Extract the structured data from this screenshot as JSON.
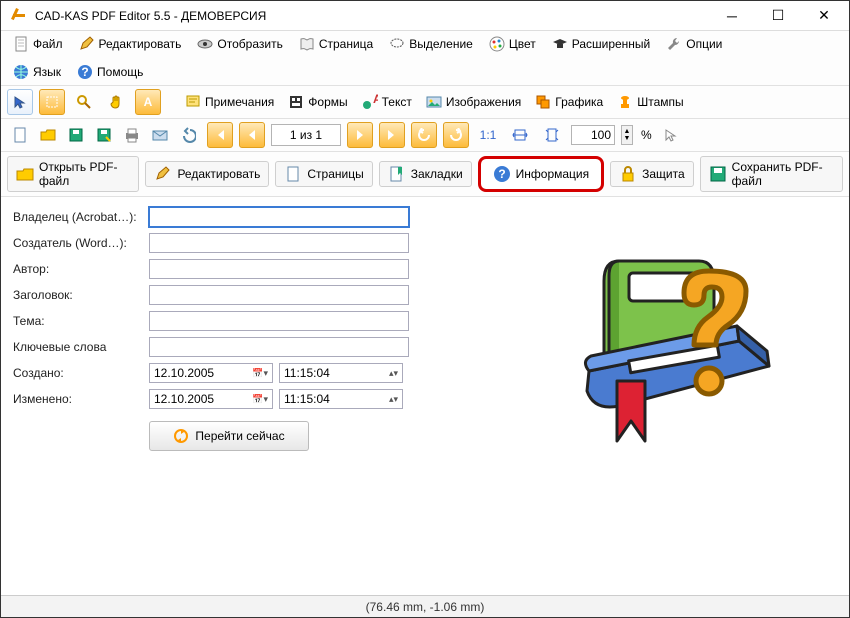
{
  "window": {
    "title": "CAD-KAS PDF Editor 5.5 - ДЕМОВЕРСИЯ"
  },
  "menu": {
    "file": "Файл",
    "edit": "Редактировать",
    "view": "Отобразить",
    "page": "Страница",
    "selection": "Выделение",
    "color": "Цвет",
    "advanced": "Расширенный",
    "options": "Опции",
    "language": "Язык",
    "help": "Помощь"
  },
  "tools": {
    "annotations": "Примечания",
    "forms": "Формы",
    "text": "Текст",
    "images": "Изображения",
    "graphics": "Графика",
    "stamps": "Штампы"
  },
  "nav": {
    "page_indicator": "1 из 1",
    "zoom": "100",
    "zoom_suffix": "%"
  },
  "tabs": {
    "open": "Открыть PDF-файл",
    "edit": "Редактировать",
    "pages": "Страницы",
    "bookmarks": "Закладки",
    "info": "Информация",
    "security": "Защита",
    "save": "Сохранить PDF-файл"
  },
  "form": {
    "owner_label": "Владелец (Acrobat…):",
    "owner": "",
    "creator_label": "Создатель (Word…):",
    "creator": "",
    "author_label": "Автор:",
    "author": "",
    "title_label": "Заголовок:",
    "title": "",
    "subject_label": "Тема:",
    "subject": "",
    "keywords_label": "Ключевые слова",
    "keywords": "",
    "created_label": "Создано:",
    "created_date": "12.10.2005",
    "created_time": "11:15:04",
    "modified_label": "Изменено:",
    "modified_date": "12.10.2005",
    "modified_time": "11:15:04",
    "go_now": "Перейти сейчас"
  },
  "status": {
    "coords": "(76.46 mm, -1.06 mm)"
  }
}
